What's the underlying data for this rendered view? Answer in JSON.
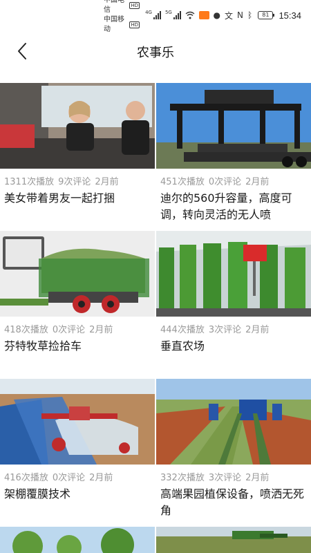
{
  "status_bar": {
    "carrier1": "中国电信",
    "carrier2": "中国移动",
    "hd": "HD",
    "net1": "4G",
    "net2": "5G",
    "battery": "81",
    "time": "15:34"
  },
  "header": {
    "title": "农事乐"
  },
  "videos": [
    {
      "plays": "1311次播放",
      "comments": "9次评论",
      "date": "2月前",
      "title": "美女带着男友一起打捆"
    },
    {
      "plays": "451次播放",
      "comments": "0次评论",
      "date": "2月前",
      "title": "迪尔的560升容量，高度可调，转向灵活的无人喷"
    },
    {
      "plays": "418次播放",
      "comments": "0次评论",
      "date": "2月前",
      "title": "芬特牧草捡拾车"
    },
    {
      "plays": "444次播放",
      "comments": "3次评论",
      "date": "2月前",
      "title": "垂直农场"
    },
    {
      "plays": "416次播放",
      "comments": "0次评论",
      "date": "2月前",
      "title": "架棚覆膜技术"
    },
    {
      "plays": "332次播放",
      "comments": "3次评论",
      "date": "2月前",
      "title": "高端果园植保设备，喷洒无死角"
    }
  ]
}
